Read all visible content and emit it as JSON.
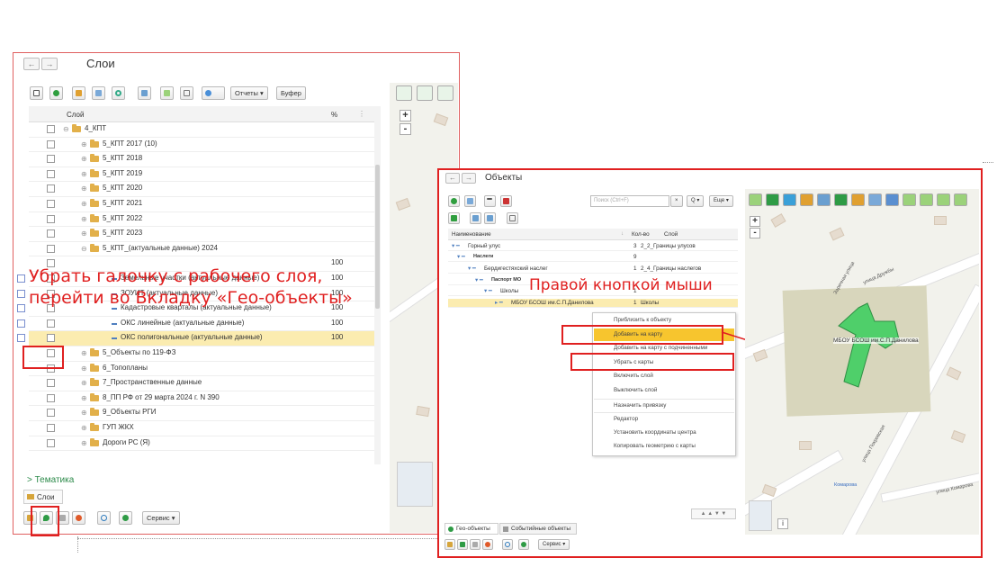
{
  "layers_window": {
    "title": "Слои",
    "toolbar": {
      "reports_label": "Отчеты ▾",
      "buffer_label": "Буфер"
    },
    "columns": {
      "layer": "Слой",
      "percent": "%"
    },
    "rows": [
      {
        "label": "4_КПТ",
        "pct": ""
      },
      {
        "label": "5_КПТ 2017 (10)",
        "pct": ""
      },
      {
        "label": "5_КПТ 2018",
        "pct": ""
      },
      {
        "label": "5_КПТ 2019",
        "pct": ""
      },
      {
        "label": "5_КПТ 2020",
        "pct": ""
      },
      {
        "label": "5_КПТ 2021",
        "pct": ""
      },
      {
        "label": "5_КПТ 2022",
        "pct": ""
      },
      {
        "label": "5_КПТ 2023",
        "pct": ""
      },
      {
        "label": "5_КПТ_(актуальные данные) 2024",
        "pct": ""
      },
      {
        "label": "",
        "pct": "100"
      },
      {
        "label": "Земельные участки (актуальные данные)",
        "pct": "100"
      },
      {
        "label": "ЗОУИТ (актуальные данные)",
        "pct": "100"
      },
      {
        "label": "Кадастровые кварталы (актуальные данные)",
        "pct": "100"
      },
      {
        "label": "ОКС линейные (актуальные данные)",
        "pct": "100"
      },
      {
        "label": "ОКС полигональные (актуальные данные)",
        "pct": "100"
      },
      {
        "label": "5_Объекты по 119-ФЗ",
        "pct": ""
      },
      {
        "label": "6_Топопланы",
        "pct": ""
      },
      {
        "label": "7_Пространственные данные",
        "pct": ""
      },
      {
        "label": "8_ПП РФ от 29 марта 2024 г. N 390",
        "pct": ""
      },
      {
        "label": "9_Объекты РГИ",
        "pct": ""
      },
      {
        "label": "ГУП ЖКХ",
        "pct": ""
      },
      {
        "label": "Дороги РС (Я)",
        "pct": ""
      }
    ],
    "thematic_label": "> Тематика",
    "layers_tab": "Слои",
    "service_label": "Сервис ▾"
  },
  "objects_window": {
    "title": "Объекты",
    "search_placeholder": "Поиск (Ctrl+F)",
    "more_label": "Еще ▾",
    "columns": {
      "name": "Наименование",
      "count": "Кол-во",
      "layer": "Слой"
    },
    "rows": [
      {
        "name": "Горный улус",
        "count": "3",
        "layer": "2_2_Границы улусов"
      },
      {
        "name": "Наслеги",
        "count": "9",
        "layer": ""
      },
      {
        "name": "Бердигестяхский наслег",
        "count": "1",
        "layer": "2_4_Границы наслегов"
      },
      {
        "name": "Паспорт МО",
        "count": "",
        "layer": ""
      },
      {
        "name": "Школы",
        "count": "1",
        "layer": ""
      },
      {
        "name": "МБОУ БСОШ им.С.П.Данилова",
        "count": "1",
        "layer": "Школы"
      }
    ],
    "context_menu": [
      "Приблизить к объекту",
      "Добавить на карту",
      "Добавить на карту с подчиненными",
      "Убрать с карты",
      "Включить слой",
      "Выключить слой",
      "Назначить привязку",
      "Редактор",
      "Установить координаты центра",
      "Копировать геометрию с карты"
    ],
    "tabs": {
      "geo": "Гео-объекты",
      "events": "Событийные объекты"
    },
    "service_label": "Сервис ▾",
    "map_label": "МБОУ БСОШ им.С.П.Данилова",
    "street_1": "улица Дружбы",
    "street_2": "Заречная улица",
    "street_3": "улица Покровская",
    "street_4": "улица Комарова",
    "street_5": "Комарова"
  },
  "annotations": {
    "left_line1": "Убрать галочку с рабочего слоя,",
    "left_line2": "перейти во Вкладку «Гео-объекты»",
    "right": "Правой кнопкой мыши"
  },
  "colors": {
    "annotation": "#e02020",
    "highlight": "#fbecb0",
    "menu_highlight": "#f7c52e",
    "object_fill": "#4fcf6a"
  }
}
